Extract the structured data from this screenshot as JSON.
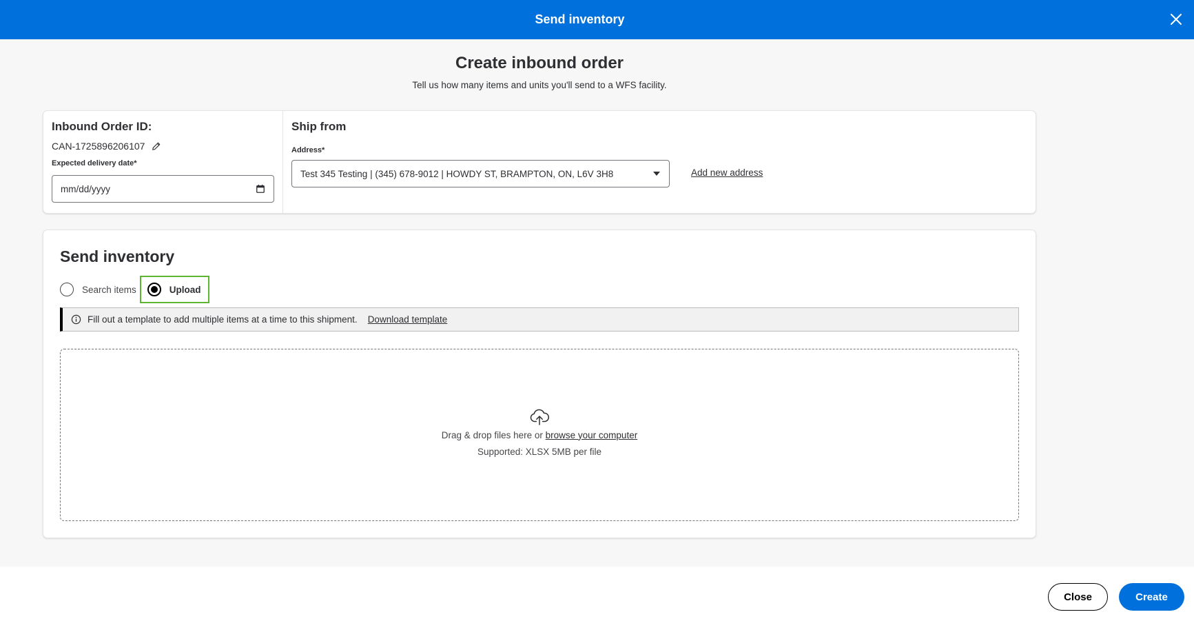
{
  "header": {
    "title": "Send inventory",
    "close_icon": "close-icon"
  },
  "page": {
    "heading": "Create inbound order",
    "subheading": "Tell us how many items and units you'll send to a WFS facility."
  },
  "order": {
    "title": "Inbound Order ID:",
    "id": "CAN-1725896206107",
    "edit_icon": "pencil-icon",
    "date_label": "Expected delivery date*",
    "date_placeholder": "mm/dd/yyyy",
    "calendar_icon": "calendar-icon"
  },
  "ship_from": {
    "title": "Ship from",
    "address_label": "Address*",
    "address_value": "Test 345 Testing | (345) 678-9012 | HOWDY ST, BRAMPTON, ON, L6V 3H8",
    "add_address_link": "Add new address"
  },
  "inventory": {
    "title": "Send inventory",
    "options": [
      {
        "label": "Search items",
        "selected": false
      },
      {
        "label": "Upload",
        "selected": true
      }
    ],
    "banner_text": "Fill out a template to add multiple items at a time to this shipment.",
    "banner_link": "Download template",
    "drop_text": "Drag & drop files here or",
    "drop_link": "browse your computer",
    "supported": "Supported: XLSX 5MB per file"
  },
  "footer": {
    "close_label": "Close",
    "create_label": "Create"
  },
  "colors": {
    "primary": "#0071dc",
    "highlight": "#5cb531"
  }
}
